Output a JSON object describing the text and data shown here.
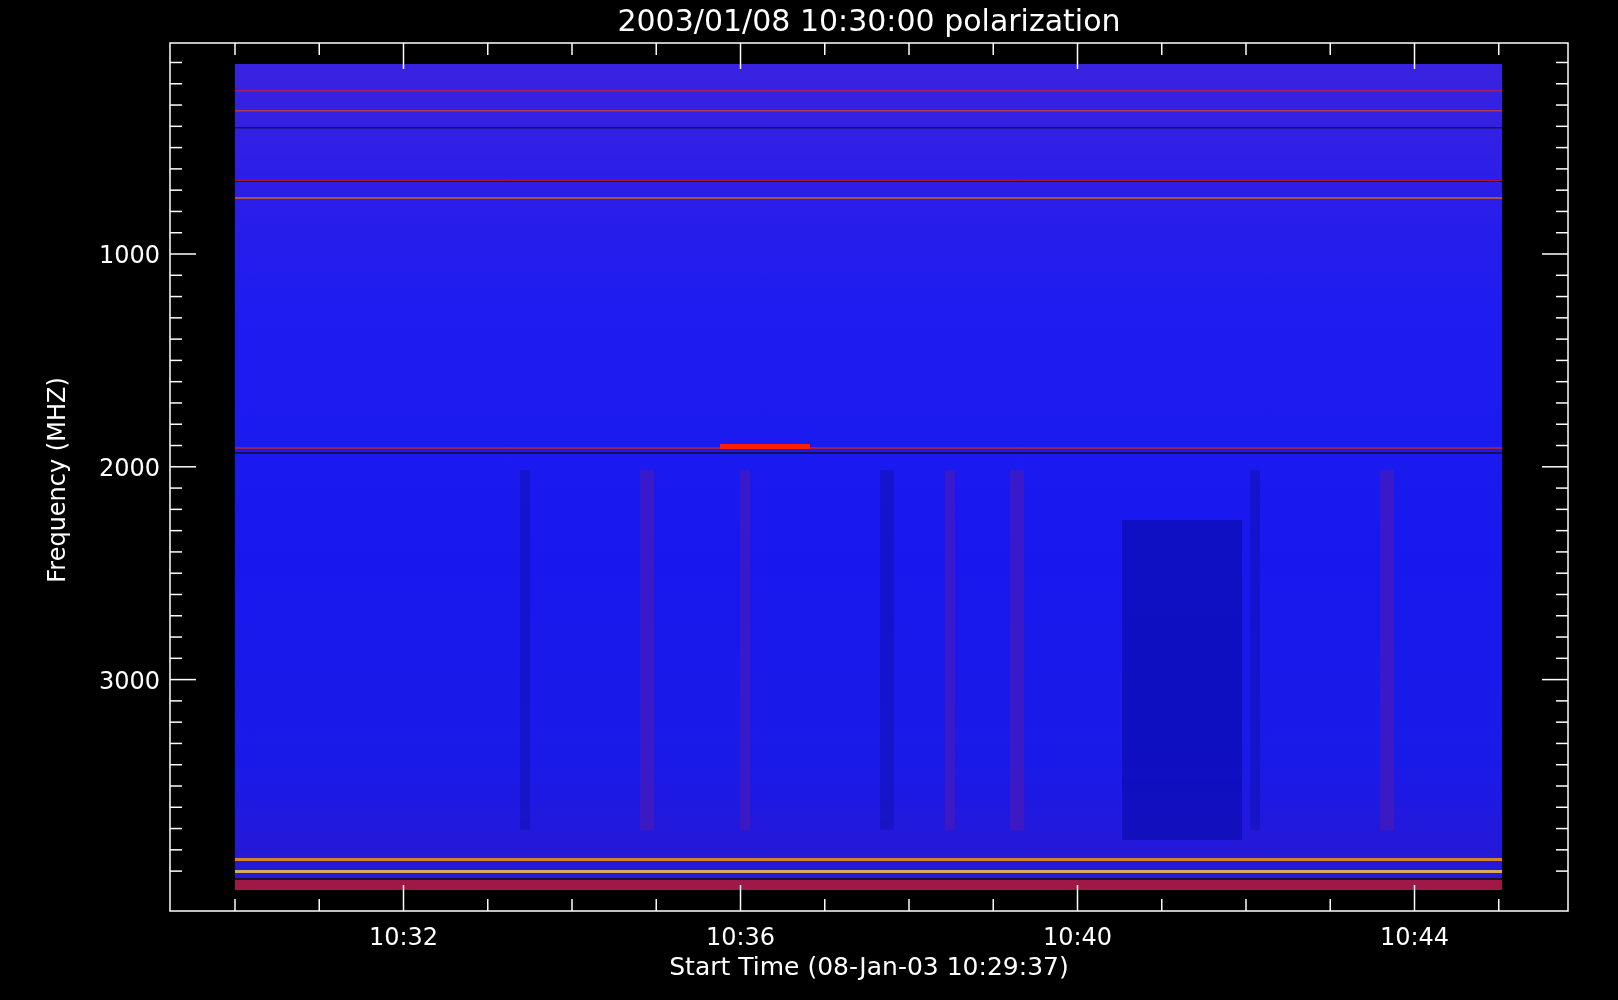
{
  "title": "2003/01/08 10:30:00 polarization",
  "y_axis": {
    "label": "Frequency (MHZ)",
    "ticks": [
      "1000",
      "2000",
      "3000"
    ]
  },
  "x_axis": {
    "label": "Start Time (08-Jan-03 10:29:37)",
    "ticks": [
      "10:32",
      "10:36",
      "10:40",
      "10:44"
    ]
  }
}
